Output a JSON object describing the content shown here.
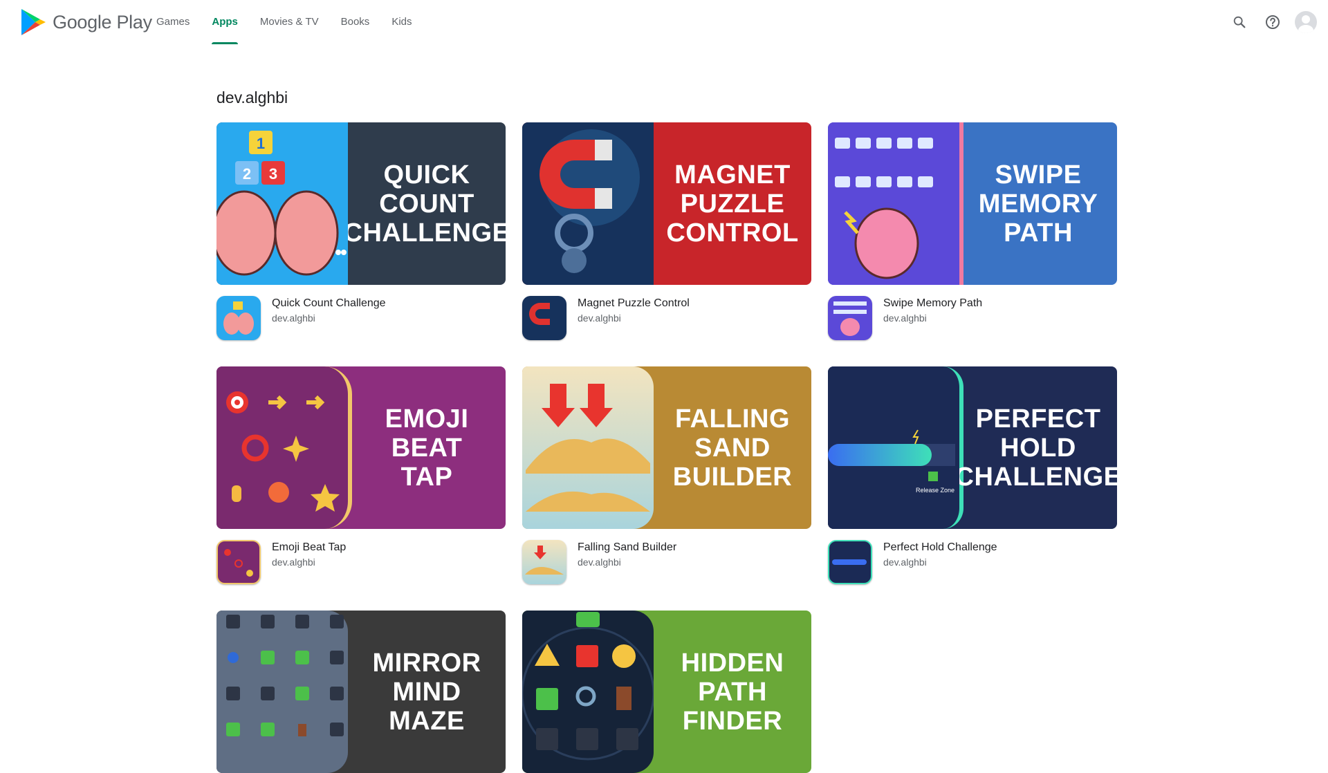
{
  "header": {
    "brand": "Google Play",
    "nav": [
      {
        "label": "Games",
        "active": false
      },
      {
        "label": "Apps",
        "active": true
      },
      {
        "label": "Movies & TV",
        "active": false
      },
      {
        "label": "Books",
        "active": false
      },
      {
        "label": "Kids",
        "active": false
      }
    ],
    "icons": [
      "search-icon",
      "help-icon",
      "account-avatar"
    ]
  },
  "page": {
    "title": "dev.alghbi"
  },
  "apps": [
    {
      "banner_title": "QUICK\nCOUNT\nCHALLENGE",
      "name": "Quick Count Challenge",
      "developer": "dev.alghbi",
      "colors": {
        "art": "#29a9ee",
        "banner": "#2f3c4c"
      }
    },
    {
      "banner_title": "MAGNET\nPUZZLE\nCONTROL",
      "name": "Magnet Puzzle Control",
      "developer": "dev.alghbi",
      "colors": {
        "art": "#16325c",
        "banner": "#c8252a"
      }
    },
    {
      "banner_title": "SWIPE\nMEMORY\nPATH",
      "name": "Swipe Memory Path",
      "developer": "dev.alghbi",
      "colors": {
        "art": "#5b49d8",
        "banner": "#3a73c4"
      }
    },
    {
      "banner_title": "EMOJI\nBEAT\nTAP",
      "name": "Emoji Beat Tap",
      "developer": "dev.alghbi",
      "colors": {
        "art": "#7a2a6e",
        "banner": "#8d2e7e"
      }
    },
    {
      "banner_title": "FALLING\nSAND\nBUILDER",
      "name": "Falling Sand Builder",
      "developer": "dev.alghbi",
      "colors": {
        "art": "#a9d4dc",
        "banner": "#b98a34"
      }
    },
    {
      "banner_title": "PERFECT\nHOLD\nCHALLENGE",
      "name": "Perfect Hold Challenge",
      "developer": "dev.alghbi",
      "colors": {
        "art": "#1b2a55",
        "banner": "#1f2b55"
      }
    },
    {
      "banner_title": "MIRROR\nMIND\nMAZE",
      "name": "",
      "developer": "",
      "colors": {
        "art": "#5f6e84",
        "banner": "#3a3a3a"
      }
    },
    {
      "banner_title": "HIDDEN\nPATH\nFINDER",
      "name": "",
      "developer": "",
      "colors": {
        "art": "#152338",
        "banner": "#6aa838"
      }
    }
  ]
}
